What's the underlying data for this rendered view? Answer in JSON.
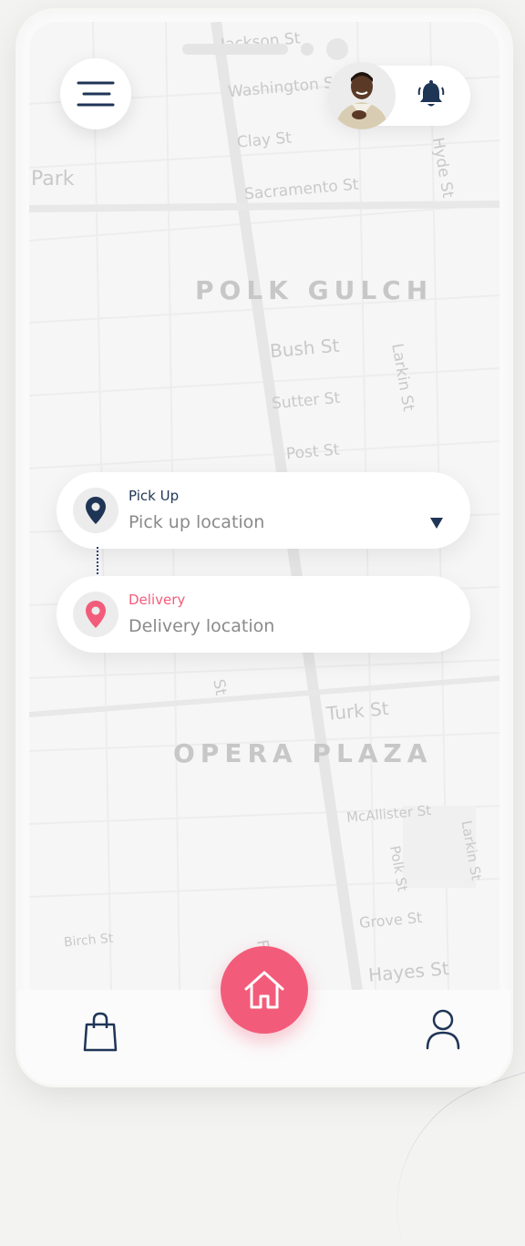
{
  "map": {
    "streets": [
      "Jackson St",
      "Washington St",
      "Clay St",
      "Sacramento St",
      "Bush St",
      "Sutter St",
      "Post St",
      "Larkin St",
      "Hyde St",
      "Turk St",
      "McAllister St",
      "Polk St",
      "Larkin St",
      "Grove St",
      "Hayes St",
      "Birch St",
      "Fra",
      "St",
      "Park"
    ],
    "districts": [
      "POLK GULCH",
      "OPERA PLAZA"
    ]
  },
  "header": {
    "menu_icon": "hamburger-menu-icon",
    "bell_icon": "notification-bell-icon"
  },
  "route": {
    "pickup": {
      "label": "Pick Up",
      "placeholder": "Pick up location",
      "icon": "location-pin-icon",
      "color": "#1f3556"
    },
    "delivery": {
      "label": "Delivery",
      "placeholder": "Delivery location",
      "icon": "location-pin-icon",
      "color": "#f25c7a"
    }
  },
  "bottom_nav": {
    "items": [
      "shopping-bag-icon",
      "home-icon",
      "profile-icon"
    ],
    "accent": "#f25c7a"
  }
}
